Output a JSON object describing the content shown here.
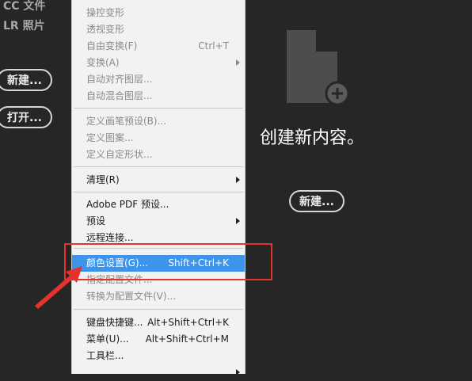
{
  "sidebar": {
    "links": [
      "CC 文件",
      "LR 照片"
    ],
    "new_button": "新建...",
    "open_button": "打开..."
  },
  "empty_state": {
    "icon": "new-document-icon",
    "title": "创建新内容。",
    "new_button": "新建..."
  },
  "menu": {
    "items": [
      {
        "label": "操控变形",
        "state": "disabled"
      },
      {
        "label": "透视变形",
        "state": "disabled"
      },
      {
        "label": "自由变换(F)",
        "shortcut": "Ctrl+T",
        "state": "disabled"
      },
      {
        "label": "变换(A)",
        "state": "disabled",
        "submenu": true
      },
      {
        "label": "自动对齐图层...",
        "state": "disabled"
      },
      {
        "label": "自动混合图层...",
        "state": "disabled"
      },
      {
        "label": "定义画笔预设(B)...",
        "state": "disabled"
      },
      {
        "label": "定义图案...",
        "state": "disabled"
      },
      {
        "label": "定义自定形状...",
        "state": "disabled"
      },
      {
        "label": "清理(R)",
        "state": "enabled",
        "submenu": true
      },
      {
        "label": "Adobe PDF 预设...",
        "state": "enabled"
      },
      {
        "label": "预设",
        "state": "enabled",
        "submenu": true
      },
      {
        "label": "远程连接...",
        "state": "enabled"
      },
      {
        "label": "颜色设置(G)...",
        "shortcut": "Shift+Ctrl+K",
        "state": "selected"
      },
      {
        "label": "指定配置文件...",
        "state": "disabled"
      },
      {
        "label": "转换为配置文件(V)...",
        "state": "disabled"
      },
      {
        "label": "键盘快捷键...",
        "shortcut": "Alt+Shift+Ctrl+K",
        "state": "enabled"
      },
      {
        "label": "菜单(U)...",
        "shortcut": "Alt+Shift+Ctrl+M",
        "state": "enabled"
      },
      {
        "label": "工具栏...",
        "state": "enabled"
      }
    ]
  },
  "colors": {
    "background": "#262626",
    "menu_background": "#f2f2f2",
    "selection": "#3d94ea",
    "annotation": "#e5322d"
  }
}
